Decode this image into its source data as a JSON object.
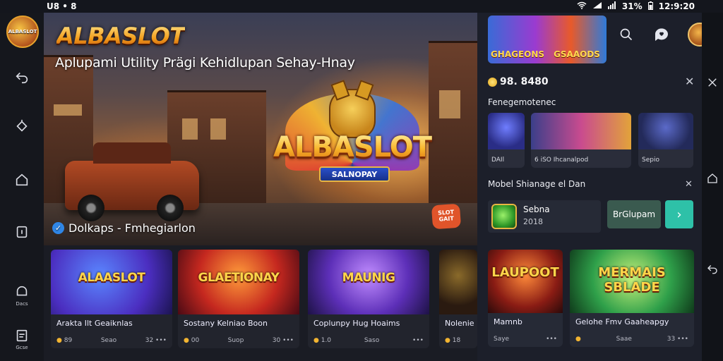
{
  "status_bar": {
    "left": "U8 • 8 ",
    "battery": "31%",
    "time": "12:9:20"
  },
  "sidebar": {
    "logo_text": "ALBASLOT",
    "items": [
      {
        "icon": "undo-icon",
        "label": ""
      },
      {
        "icon": "refresh-icon",
        "label": ""
      },
      {
        "icon": "home-icon",
        "label": ""
      },
      {
        "icon": "square-icon",
        "label": ""
      },
      {
        "icon": "notification-icon",
        "label": "Dacs"
      },
      {
        "icon": "document-icon",
        "label": "Gcse"
      }
    ]
  },
  "hero": {
    "brand_title": "ALBASLOT",
    "subtitle": "Aplupami Utility Prägi Kehidlupan Sehay-Hnay",
    "logo_main": "ALBASLOT",
    "logo_ribbon": "SALNOPAY",
    "verified_text": "Dolkaps - Fmhegiarlon",
    "corner_chip": "SLOT GAIT"
  },
  "game_cards": [
    {
      "thumb_title": "ALAASLOT",
      "name": "Arakta Ilt Geaiknlas",
      "rating": "89",
      "provider": "Seao",
      "count": "32 •••"
    },
    {
      "thumb_title": "GLAETIONAY",
      "name": "Sostany Kelniao Boon",
      "rating": "00",
      "provider": "Suop",
      "count": "30 •••"
    },
    {
      "thumb_title": "MAUNIG",
      "name": "Coplunpy Hug Hoaims",
      "rating": "1.0",
      "provider": "Saso",
      "count": "•••"
    },
    {
      "thumb_title": "",
      "name": "Nolenie",
      "rating": "18",
      "provider": "",
      "count": ""
    }
  ],
  "right_panel": {
    "promo": {
      "left_text": "GHAGEONS",
      "right_text": "GSAAODS"
    },
    "balance": "98. 8480",
    "section_featured": "Fenegemotenec",
    "featured": [
      {
        "caption": "DAIl"
      },
      {
        "caption": "6 iSO Ihcanalpod"
      },
      {
        "caption": "Sepio"
      }
    ],
    "section_mobile": "Mobel Shianage el Dan",
    "mobile_app": {
      "title": "Sebna",
      "year": "2018"
    },
    "download_label": "BrGlupam",
    "go_label": "›",
    "cards": [
      {
        "thumb_title": "LAUPOOT",
        "name": "Mamnb",
        "rating": "",
        "provider": "Saye",
        "count": "•••"
      },
      {
        "thumb_title": "MERMAIS SBLADE",
        "name": "Gelohe Fmv Gaaheapgy",
        "rating": "",
        "provider": "Saae",
        "count": "33 •••"
      }
    ]
  },
  "colors": {
    "accent_teal": "#2ec1a8",
    "gold": "#f2b431",
    "panel_bg": "#1c1f2a"
  }
}
